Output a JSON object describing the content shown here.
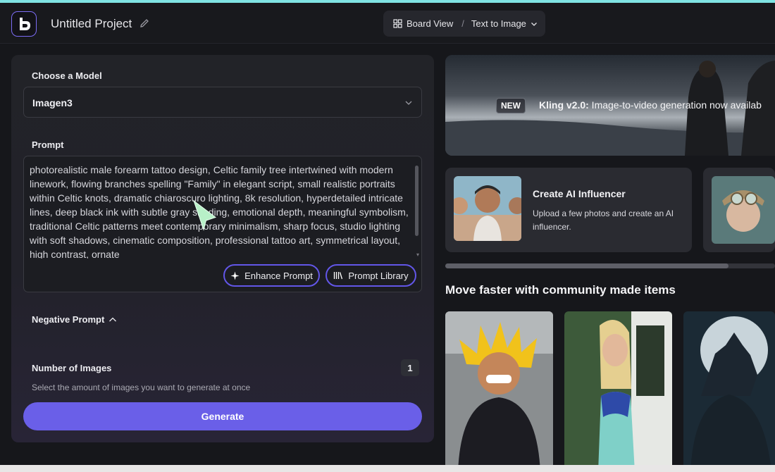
{
  "header": {
    "project_title": "Untitled Project",
    "view_label": "Board View",
    "breadcrumb_separator": "/",
    "mode_label": "Text to Image"
  },
  "form": {
    "model_label": "Choose a Model",
    "model_value": "Imagen3",
    "prompt_label": "Prompt",
    "prompt_text": "photorealistic male forearm tattoo design, Celtic family tree intertwined with modern linework, flowing branches spelling \"Family\" in elegant script, small realistic portraits within Celtic knots, dramatic chiaroscuro lighting, 8k resolution, hyperdetailed intricate lines, deep black ink with subtle gray shading, emotional depth, meaningful symbolism, traditional Celtic patterns meet contemporary minimalism, sharp focus, studio lighting with soft shadows, cinematic composition, professional tattoo art, symmetrical layout, high contrast, ornate",
    "enhance_label": "Enhance Prompt",
    "library_label": "Prompt Library",
    "negative_label": "Negative Prompt",
    "images_label": "Number of Images",
    "images_count": "1",
    "images_hint": "Select the amount of images you want to generate at once",
    "generate_label": "Generate"
  },
  "banner": {
    "badge": "NEW",
    "title": "Kling v2.0:",
    "text": " Image-to-video generation now availab"
  },
  "feature_cards": [
    {
      "title": "Create AI Influencer",
      "description": "Upload a few photos and create an AI influencer."
    }
  ],
  "community": {
    "heading": "Move faster with community made items"
  },
  "colors": {
    "accent": "#6a5fe8",
    "outline": "#6256e8",
    "background": "#16171b",
    "panel": "#222328",
    "topline": "#7fe3e3"
  },
  "icons": [
    "logo-icon",
    "pencil-icon",
    "grid-icon",
    "chevron-down-icon",
    "sparkle-icon",
    "library-icon",
    "chevron-up-icon",
    "cursor-arrow-icon"
  ]
}
